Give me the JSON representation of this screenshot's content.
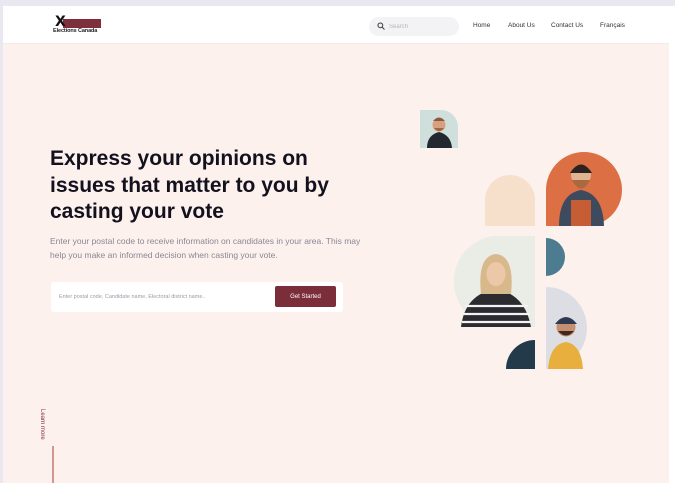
{
  "brand": {
    "name": "Elections Canada",
    "logo_mark": "X",
    "accent": "#7b2d3a"
  },
  "nav": {
    "search_placeholder": "Search",
    "links": [
      "Home",
      "About Us",
      "Contact Us",
      "Français"
    ]
  },
  "hero": {
    "headline": "Express your opinions on issues that matter to you by casting your vote",
    "subheadline": "Enter your postal code to receive information on candidates in your area. This may help you make an informed decision when casting your vote.",
    "input_placeholder": "Enter postal code, Candidate name, Electoral district name..",
    "cta_label": "Get Started",
    "learn_more": "Learn more"
  },
  "colors": {
    "hero_bg": "#fcf1ec",
    "headline": "#14111f",
    "orange": "#dd6f44",
    "peach": "#f6dfcb",
    "teal": "#4d7b8f",
    "navy": "#233a4b",
    "sage": "#e8ece3"
  }
}
